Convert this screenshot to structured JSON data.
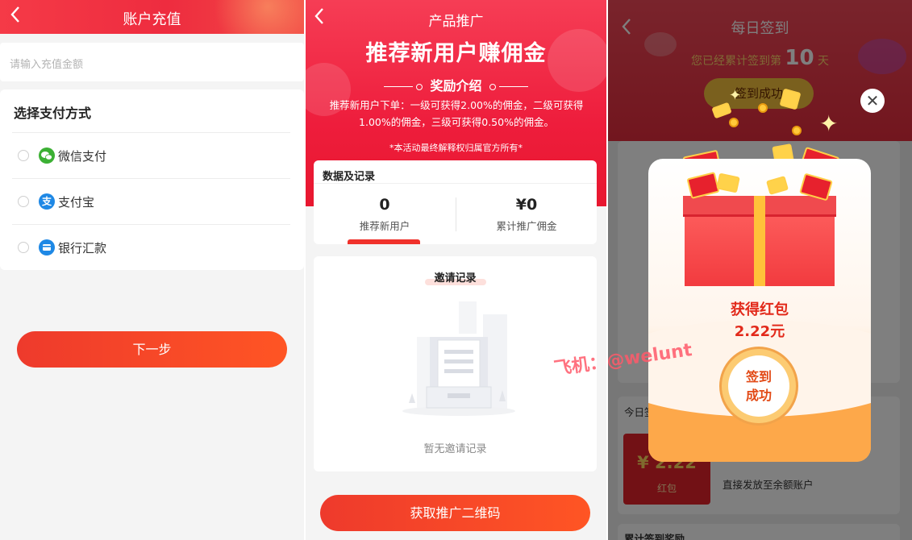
{
  "recharge": {
    "back_icon": "chevron-left-icon",
    "title": "账户充值",
    "amount_placeholder": "请输入充值金额",
    "pay_title": "选择支付方式",
    "methods": [
      {
        "label": "微信支付",
        "icon": "wechat-icon",
        "icon_glyph": "●",
        "color": "#3cb034"
      },
      {
        "label": "支付宝",
        "icon": "alipay-icon",
        "icon_glyph": "支",
        "color": "#1e88e5"
      },
      {
        "label": "银行汇款",
        "icon": "bank-card-icon",
        "icon_glyph": "▬",
        "color": "#1e88e5"
      }
    ],
    "next_button": "下一步"
  },
  "promo": {
    "back_icon": "chevron-left-icon",
    "title": "产品推广",
    "headline": "推荐新用户赚佣金",
    "reward_title": "奖励介绍",
    "reward_desc": "推荐新用户下单：一级可获得2.00%的佣金，二级可获得1.00%的佣金，三级可获得0.50%的佣金。",
    "note": "*本活动最终解释权归属官方所有*",
    "stats_title": "数据及记录",
    "stat_users_value": "0",
    "stat_users_label": "推荐新用户",
    "stat_commission_value": "¥0",
    "stat_commission_label": "累计推广佣金",
    "invite_title": "邀请记录",
    "invite_empty": "暂无邀请记录",
    "qr_button": "获取推广二维码"
  },
  "checkin": {
    "back_icon": "chevron-left-icon",
    "title": "每日签到",
    "days_prefix": "您已经累计签到第",
    "days_value": "10",
    "days_suffix": "天",
    "signed_button": "签到成功",
    "today_label": "今日签",
    "reward_value": "¥ 2.22",
    "reward_type": "红包",
    "reward_desc": "直接发放至余额账户",
    "bottom_label": "累计签到奖励",
    "modal": {
      "title": "获得红包",
      "amount": "2.22元",
      "button_line1": "签到",
      "button_line2": "成功",
      "close_icon": "close-icon",
      "coin_label": "¥"
    }
  },
  "watermark": "飞机：@welunt",
  "colors": {
    "primary_red": "#ee2c3f",
    "button_gradient_start": "#ee3a2c",
    "button_gradient_end": "#ff5524",
    "gold": "#ffc23a"
  }
}
